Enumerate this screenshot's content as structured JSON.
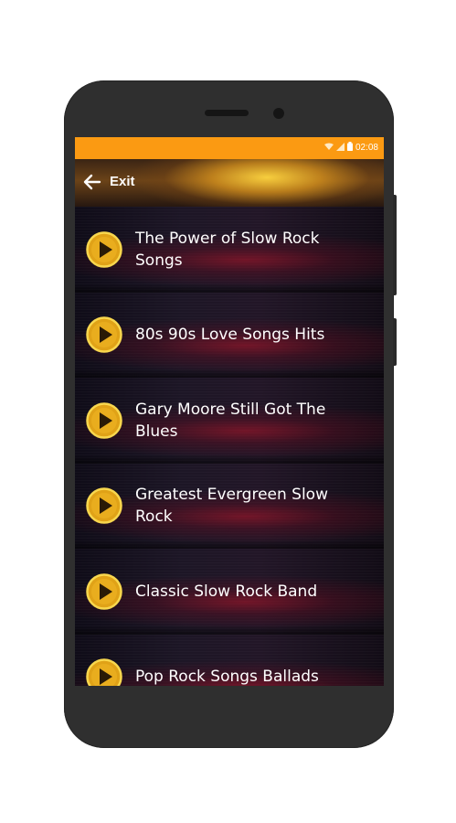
{
  "status_bar": {
    "time": "02:08",
    "icons": [
      "wifi-icon",
      "signal-icon",
      "battery-icon"
    ]
  },
  "app_bar": {
    "back_icon": "arrow-left-icon",
    "title": "Exit"
  },
  "songs": [
    {
      "title": "The Power of Slow Rock Songs"
    },
    {
      "title": "80s 90s Love Songs Hits"
    },
    {
      "title": "Gary Moore Still Got The Blues"
    },
    {
      "title": "Greatest Evergreen Slow Rock"
    },
    {
      "title": "Classic Slow Rock Band"
    },
    {
      "title": "Pop Rock Songs Ballads"
    }
  ],
  "colors": {
    "status_bar": "#fb9a12",
    "play_button_fill": "#e3a81a",
    "play_button_ring": "#f7d34a",
    "background": "#0d0a10",
    "phone_body": "#2f2f2f"
  }
}
